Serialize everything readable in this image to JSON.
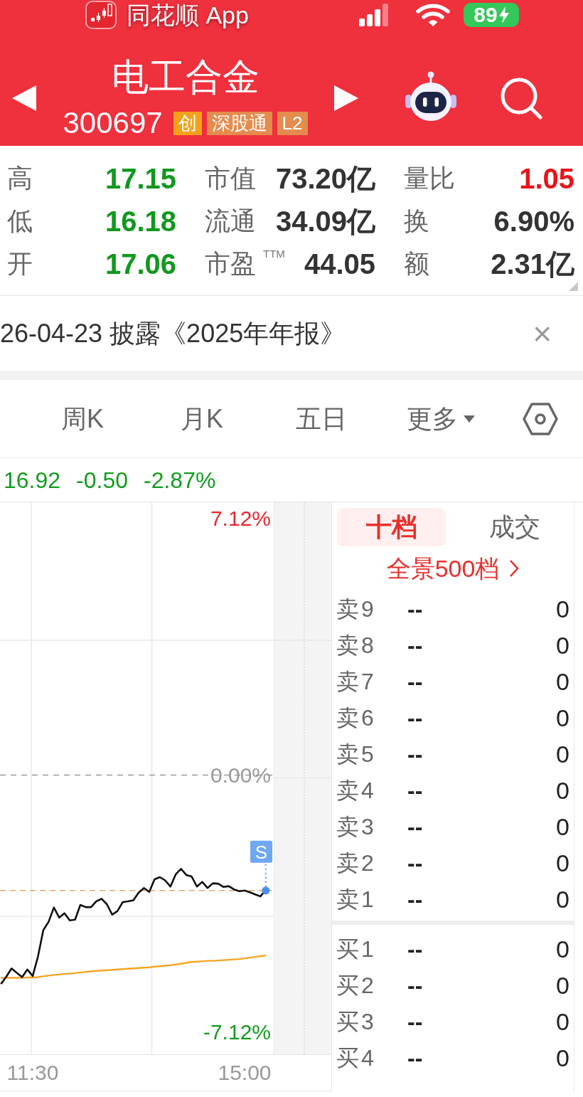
{
  "status_bar": {
    "app_name": "同花顺 App",
    "battery": "89"
  },
  "header": {
    "title": "电工合金",
    "code": "300697",
    "badges": [
      {
        "text": "创",
        "color": "#f5a11c"
      },
      {
        "text": "深股通",
        "color": "#e48c4e"
      },
      {
        "text": "L2",
        "color": "#e48c4e"
      }
    ]
  },
  "stats": [
    {
      "label": "高",
      "value": "17.15",
      "color": "#11981d"
    },
    {
      "label": "市值",
      "value": "73.20亿",
      "color": "#333333"
    },
    {
      "label": "量比",
      "value": "1.05",
      "color": "#e8141c"
    },
    {
      "label": "低",
      "value": "16.18",
      "color": "#11981d"
    },
    {
      "label": "流通",
      "value": "34.09亿",
      "color": "#333333"
    },
    {
      "label": "换",
      "value": "6.90%",
      "color": "#333333"
    },
    {
      "label": "开",
      "value": "17.06",
      "color": "#11981d"
    },
    {
      "label": "市盈$^{TTM}$",
      "value": "44.05",
      "color": "#333333"
    },
    {
      "label": "额",
      "value": "2.31亿",
      "color": "#333333"
    }
  ],
  "notice": {
    "text": "26-04-23 披露《2025年年报》",
    "close": "×"
  },
  "period_tabs": [
    {
      "label": "周K",
      "kind": "tab",
      "selected": false
    },
    {
      "label": "月K",
      "kind": "tab",
      "selected": false
    },
    {
      "label": "五日",
      "kind": "tab",
      "selected": false
    },
    {
      "label": "更多",
      "kind": "dropdown",
      "selected": false
    }
  ],
  "quote": {
    "price": "16.92",
    "change": "-0.50",
    "change_percent": "-2.87%"
  },
  "chart": {
    "chart_data": {
      "type": "line",
      "categories": [
        null,
        null,
        null,
        null,
        null,
        null,
        "11:30",
        null,
        null,
        null,
        null,
        null,
        null,
        null,
        null,
        null,
        null,
        null,
        null,
        null,
        null,
        null,
        null,
        null,
        null,
        null,
        null,
        null,
        null,
        null,
        null,
        null,
        null,
        null,
        null,
        null,
        null,
        null,
        null,
        null,
        null,
        null,
        null,
        null,
        null,
        null,
        "15:00",
        null,
        null,
        null,
        null
      ],
      "series": [
        {
          "color": "#f5a623",
          "values": [
            -5.62,
            -5.62,
            -5.62,
            -5.62,
            -5.62,
            -5.61,
            -5.61,
            -5.6,
            -5.58,
            -5.56,
            -5.54,
            -5.53,
            -5.51,
            -5.5,
            -5.49,
            -5.47,
            -5.46,
            -5.44,
            -5.43,
            -5.42,
            -5.41,
            -5.4,
            -5.39,
            -5.38,
            -5.37,
            -5.36,
            -5.35,
            -5.34,
            -5.33,
            -5.31,
            -5.3,
            -5.28,
            -5.27,
            -5.25,
            -5.23,
            -5.2,
            -5.18,
            -5.17,
            -5.16,
            -5.15,
            -5.15,
            -5.14,
            -5.13,
            -5.12,
            -5.11,
            -5.1,
            -5.08,
            -5.06,
            -5.04,
            -5.02,
            -5.0
          ]
        },
        {
          "color": "#111111",
          "values": [
            -5.79,
            -5.59,
            -5.36,
            -5.48,
            -5.6,
            -5.39,
            -5.57,
            -5.03,
            -4.3,
            -4.07,
            -3.67,
            -3.95,
            -3.83,
            -4.03,
            -4.01,
            -3.6,
            -3.66,
            -3.66,
            -3.5,
            -3.43,
            -3.58,
            -3.87,
            -3.77,
            -3.52,
            -3.5,
            -3.47,
            -3.26,
            -3.13,
            -3.24,
            -2.89,
            -2.83,
            -2.92,
            -3.09,
            -2.75,
            -2.6,
            -2.77,
            -2.81,
            -3.09,
            -2.96,
            -3.13,
            -3.0,
            -3.01,
            -3.1,
            -3.08,
            -3.17,
            -3.22,
            -3.2,
            -3.25,
            -3.31,
            -3.36,
            -3.18
          ]
        }
      ],
      "ylim": [
        -7.74,
        7.56
      ],
      "yticks": [
        {
          "value": 7.12,
          "label": "7.12%"
        },
        {
          "value": 0,
          "label": "0.00%"
        },
        {
          "value": -7.12,
          "label": "-7.12%"
        }
      ],
      "ref_lines": [
        {
          "axis": "y",
          "value": 0
        },
        {
          "axis": "y",
          "value": -3.2
        }
      ],
      "annotations": [
        {
          "text": "S",
          "y": -3.2
        }
      ]
    }
  },
  "order_book": {
    "tabs": [
      {
        "label": "十档",
        "selected": true
      },
      {
        "label": "成交",
        "selected": false
      }
    ],
    "depth_link": "全景500档",
    "asks": [
      {
        "label": "卖9",
        "price": "--",
        "volume": "0"
      },
      {
        "label": "卖8",
        "price": "--",
        "volume": "0"
      },
      {
        "label": "卖7",
        "price": "--",
        "volume": "0"
      },
      {
        "label": "卖6",
        "price": "--",
        "volume": "0"
      },
      {
        "label": "卖5",
        "price": "--",
        "volume": "0"
      },
      {
        "label": "卖4",
        "price": "--",
        "volume": "0"
      },
      {
        "label": "卖3",
        "price": "--",
        "volume": "0"
      },
      {
        "label": "卖2",
        "price": "--",
        "volume": "0"
      },
      {
        "label": "卖1",
        "price": "--",
        "volume": "0"
      }
    ],
    "bids": [
      {
        "label": "买1",
        "price": "--",
        "volume": "0"
      },
      {
        "label": "买2",
        "price": "--",
        "volume": "0"
      },
      {
        "label": "买3",
        "price": "--",
        "volume": "0"
      },
      {
        "label": "买4",
        "price": "--",
        "volume": "0"
      }
    ]
  }
}
